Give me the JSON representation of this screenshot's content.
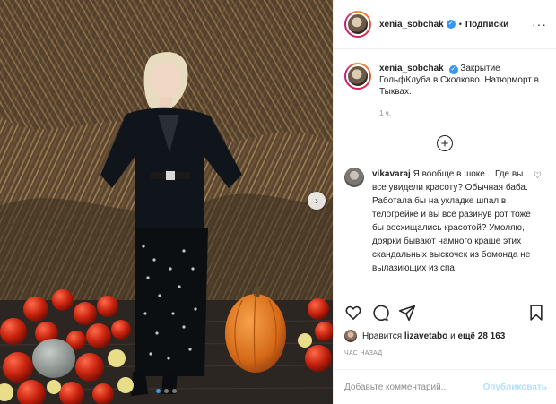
{
  "post": {
    "username": "xenia_sobchak",
    "separator": "•",
    "follow_label": "Подписки",
    "more_icon": "more-options-icon",
    "caption_text": "Закрытие ГольфКлуба в Сколково. Натюрморт в Тыквах.",
    "time_ago": "1 ч.",
    "load_more_icon": "plus-circle-icon",
    "comment": {
      "username": "vikavaraj",
      "text": "Я вообще в шоке... Где вы все увидели красоту? Обычная баба. Работала бы на укладке шпал в телогрейке и вы все разинув рот тоже бы восхищались красотой? Умоляю, доярки бывают намного краше этих скандальных выскочек из бомонда не вылазиющих из спа"
    },
    "likes": {
      "prefix": "Нравится",
      "user": "lizavetabo",
      "middle": "и",
      "count": "ещё 28 163"
    },
    "posted_ago": "ЧАС НАЗАД",
    "comment_placeholder": "Добавьте комментарий...",
    "post_button": "Опубликовать"
  },
  "photo": {
    "carousel_total": 3,
    "carousel_active": 1
  },
  "colors": {
    "accent": "#3897f0",
    "muted": "#8e8e8e",
    "post_button_disabled": "#b2dffc"
  }
}
